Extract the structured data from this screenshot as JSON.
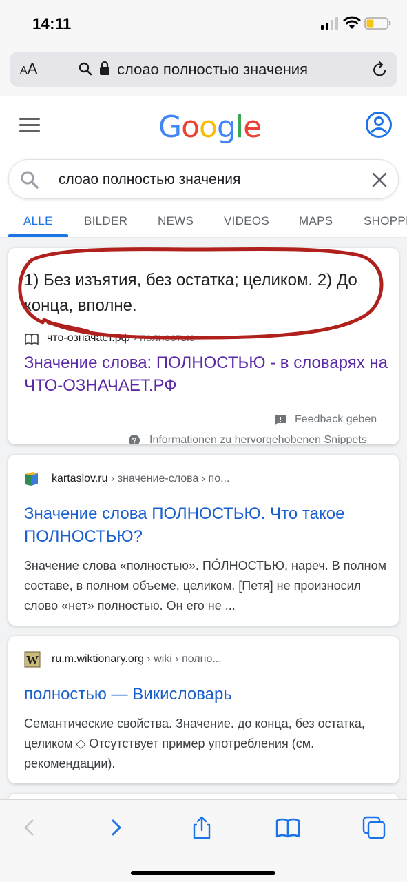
{
  "status": {
    "time": "14:11"
  },
  "address_bar": {
    "aa_label_small": "A",
    "aa_label_big": "A",
    "url_text": "слоао полностью значения"
  },
  "google": {
    "logo_letters": [
      {
        "ch": "G",
        "color": "#4285F4"
      },
      {
        "ch": "o",
        "color": "#EA4335"
      },
      {
        "ch": "o",
        "color": "#FBBC05"
      },
      {
        "ch": "g",
        "color": "#4285F4"
      },
      {
        "ch": "l",
        "color": "#34A853"
      },
      {
        "ch": "e",
        "color": "#EA4335"
      }
    ],
    "search_query": "слоао полностью значения"
  },
  "tabs": [
    "ALLE",
    "BILDER",
    "NEWS",
    "VIDEOS",
    "MAPS",
    "SHOPPING"
  ],
  "featured_snippet": {
    "text": "1) Без изъятия, без остатка; целиком. 2) До конца, вполне.",
    "source_site": "что-означает.рф",
    "source_crumb": " › полностью",
    "title": "Значение слова: ПОЛНОСТЬЮ - в словарях на ЧТО-ОЗНАЧАЕТ.РФ",
    "feedback": "Feedback geben",
    "info": "Informationen zu hervorgehobenen Snippets"
  },
  "results": [
    {
      "site": "kartaslov.ru",
      "crumb": " › значение-слова › по...",
      "title": "Значение слова ПОЛНОСТЬЮ. Что такое ПОЛНОСТЬЮ?",
      "description": "Значение слова «полностью». ПО́ЛНОСТЬЮ, нареч. В полном составе, в полном объеме, целиком. [Петя] не произносил слово «нет» полностью. Он его не ..."
    },
    {
      "site": "ru.m.wiktionary.org",
      "crumb": " › wiki › полно...",
      "title": "полностью — Викисловарь",
      "description": "Семантические свойства. Значение. до конца, без остатка, целиком ◇ Отсутствует пример употребления (см. рекомендации)."
    }
  ],
  "colors": {
    "link_blue": "#1a5fce",
    "visited_purple": "#5b2aa7",
    "tab_active": "#1a73e8",
    "annotation_red": "#b0201c"
  }
}
